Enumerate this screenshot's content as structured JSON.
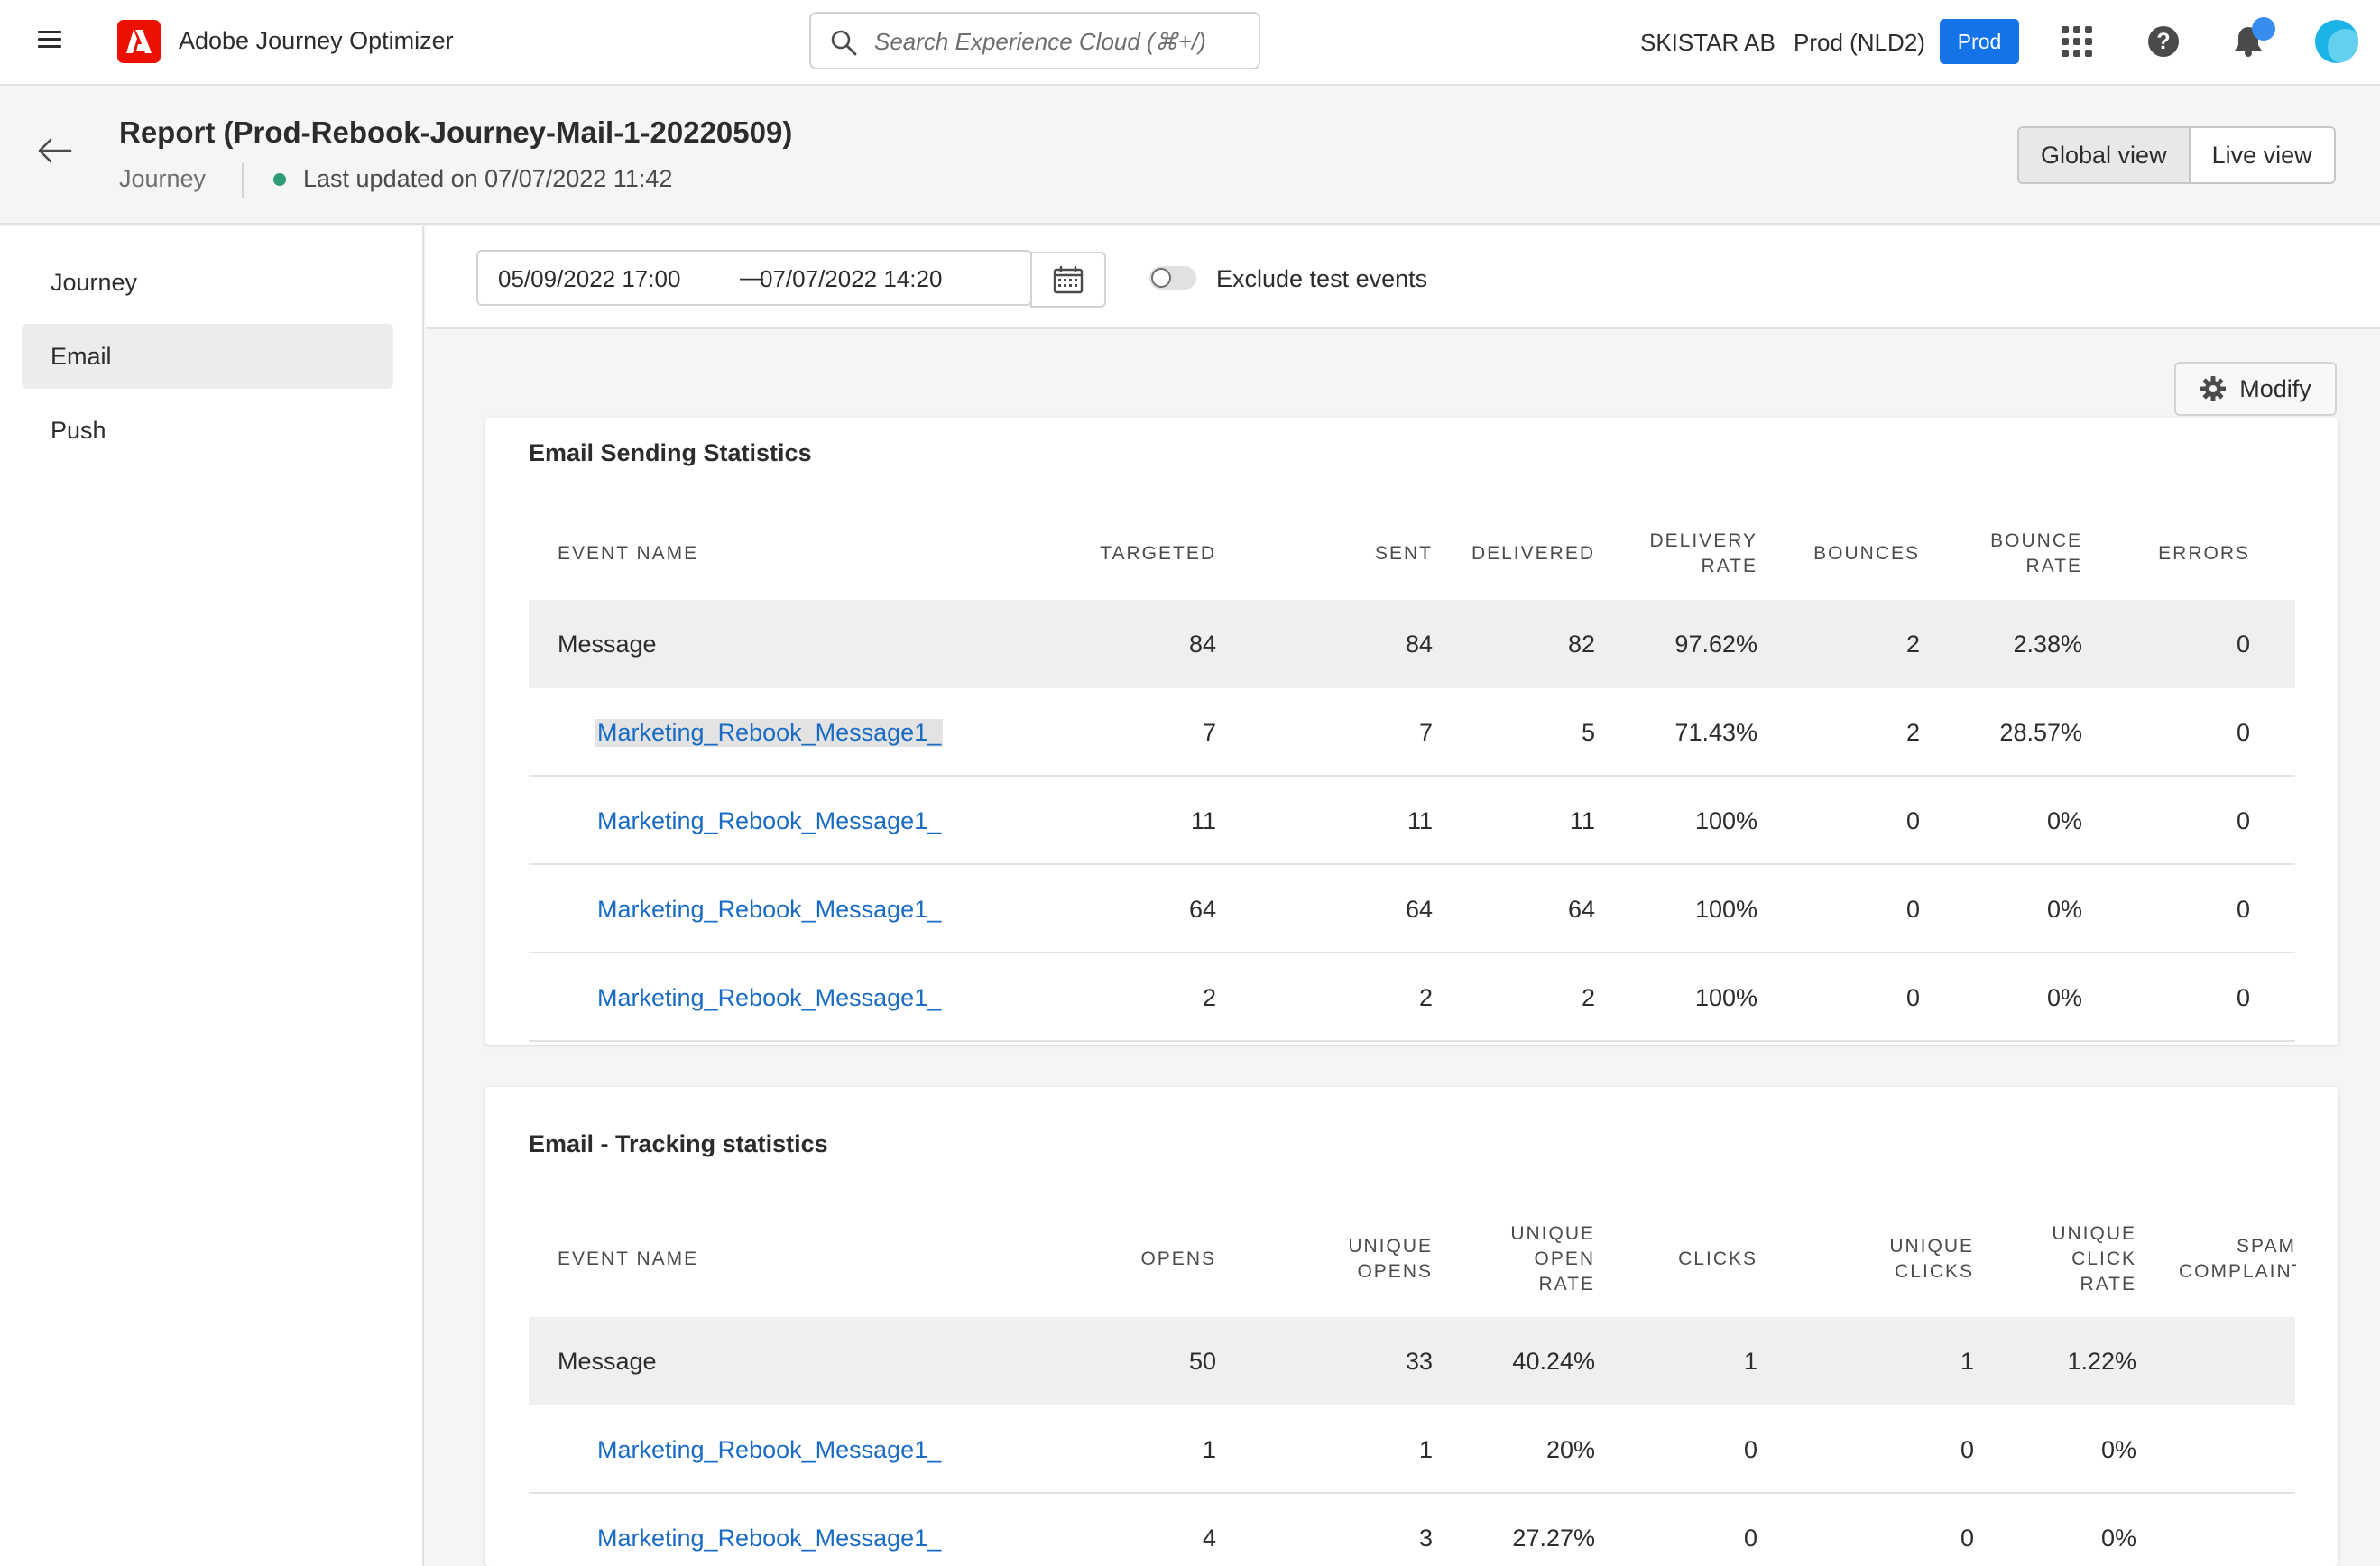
{
  "topbar": {
    "app_name": "Adobe Journey Optimizer",
    "search_placeholder": "Search Experience Cloud (⌘+/)",
    "org": "SKISTAR AB",
    "sandbox": "Prod (NLD2)",
    "env_badge": "Prod"
  },
  "header": {
    "title": "Report (Prod-Rebook-Journey-Mail-1-20220509)",
    "breadcrumb": "Journey",
    "last_updated": "Last updated on 07/07/2022 11:42",
    "views": [
      "Global view",
      "Live view"
    ]
  },
  "sidebar": {
    "items": [
      "Journey",
      "Email",
      "Push"
    ],
    "active": "Email"
  },
  "filters": {
    "date_start": "05/09/2022 17:00",
    "date_end": "07/07/2022 14:20",
    "exclude_test_label": "Exclude test events",
    "exclude_test_on": false
  },
  "modify_label": "Modify",
  "sending": {
    "title": "Email Sending Statistics",
    "columns": {
      "event_name": "EVENT NAME",
      "targeted": "TARGETED",
      "sent": "SENT",
      "delivered": "DELIVERED",
      "delivery_rate": [
        "DELIVERY",
        "RATE"
      ],
      "bounces": "BOUNCES",
      "bounce_rate": [
        "BOUNCE",
        "RATE"
      ],
      "errors": "ERRORS"
    },
    "rows": [
      {
        "name": "Message",
        "targeted": "84",
        "sent": "84",
        "delivered": "82",
        "delivery_rate": "97.62%",
        "bounces": "2",
        "bounce_rate": "2.38%",
        "errors": "0"
      },
      {
        "name": "Marketing_Rebook_Message1_",
        "targeted": "7",
        "sent": "7",
        "delivered": "5",
        "delivery_rate": "71.43%",
        "bounces": "2",
        "bounce_rate": "28.57%",
        "errors": "0"
      },
      {
        "name": "Marketing_Rebook_Message1_",
        "targeted": "11",
        "sent": "11",
        "delivered": "11",
        "delivery_rate": "100%",
        "bounces": "0",
        "bounce_rate": "0%",
        "errors": "0"
      },
      {
        "name": "Marketing_Rebook_Message1_",
        "targeted": "64",
        "sent": "64",
        "delivered": "64",
        "delivery_rate": "100%",
        "bounces": "0",
        "bounce_rate": "0%",
        "errors": "0"
      },
      {
        "name": "Marketing_Rebook_Message1_",
        "targeted": "2",
        "sent": "2",
        "delivered": "2",
        "delivery_rate": "100%",
        "bounces": "0",
        "bounce_rate": "0%",
        "errors": "0"
      }
    ]
  },
  "tracking": {
    "title": "Email - Tracking statistics",
    "columns": {
      "event_name": "EVENT NAME",
      "opens": "OPENS",
      "unique_opens": [
        "UNIQUE",
        "OPENS"
      ],
      "unique_open_rate": [
        "UNIQUE",
        "OPEN",
        "RATE"
      ],
      "clicks": "CLICKS",
      "unique_clicks": [
        "UNIQUE",
        "CLICKS"
      ],
      "unique_click_rate": [
        "UNIQUE",
        "CLICK",
        "RATE"
      ],
      "spam_complaints": [
        "SPAM",
        "COMPLAINTS"
      ]
    },
    "rows": [
      {
        "name": "Message",
        "opens": "50",
        "unique_opens": "33",
        "unique_open_rate": "40.24%",
        "clicks": "1",
        "unique_clicks": "1",
        "unique_click_rate": "1.22%"
      },
      {
        "name": "Marketing_Rebook_Message1_",
        "opens": "1",
        "unique_opens": "1",
        "unique_open_rate": "20%",
        "clicks": "0",
        "unique_clicks": "0",
        "unique_click_rate": "0%"
      },
      {
        "name": "Marketing_Rebook_Message1_",
        "opens": "4",
        "unique_opens": "3",
        "unique_open_rate": "27.27%",
        "clicks": "0",
        "unique_clicks": "0",
        "unique_click_rate": "0%"
      }
    ]
  },
  "colors": {
    "accent": "#1473e6",
    "link": "#1a6bc4",
    "status_ok": "#2d9d78",
    "brand": "#eb1000"
  }
}
